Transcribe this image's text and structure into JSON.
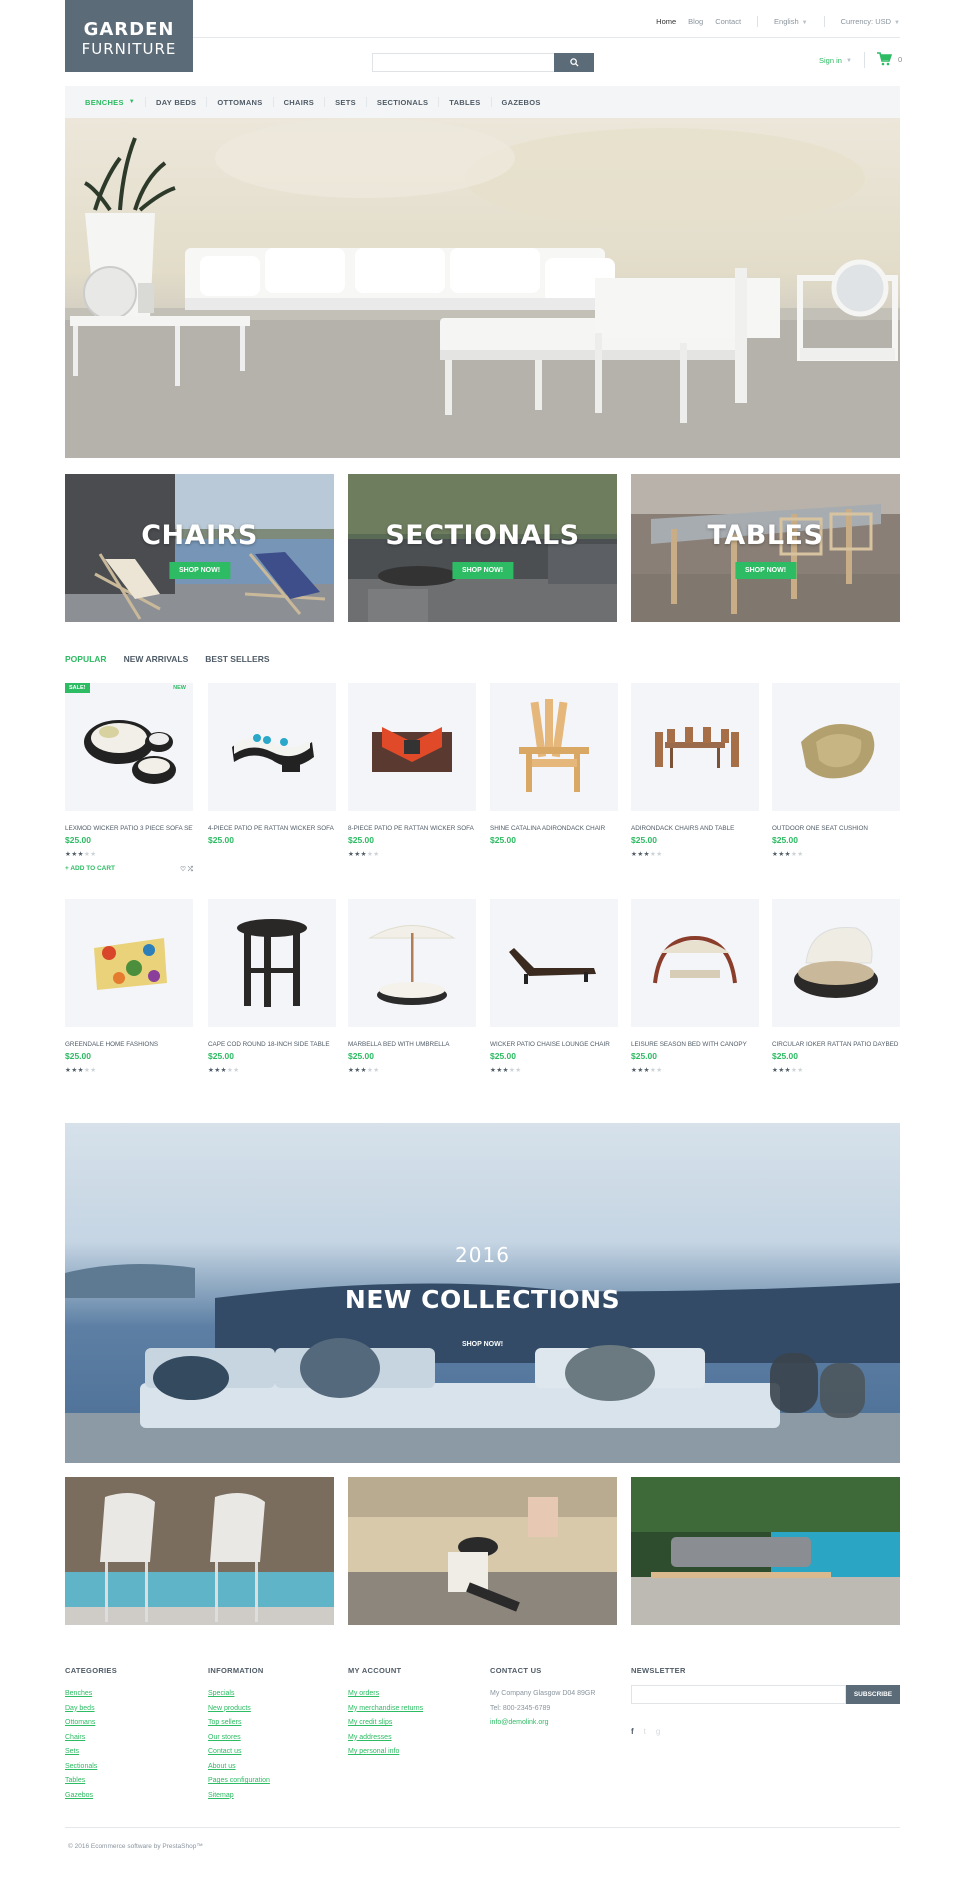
{
  "logo": {
    "line1": "GARDEN",
    "line2": "FURNITURE"
  },
  "topnav": {
    "home": "Home",
    "blog": "Blog",
    "contact": "Contact",
    "language": "English",
    "currency": "Currency: USD"
  },
  "search": {
    "placeholder": "",
    "value": ""
  },
  "account": {
    "signin": "Sign in",
    "cart_count": "0"
  },
  "menu": [
    "BENCHES",
    "DAY BEDS",
    "OTTOMANS",
    "CHAIRS",
    "SETS",
    "SECTIONALS",
    "TABLES",
    "GAZEBOS"
  ],
  "categories": [
    {
      "title": "CHAIRS",
      "button": "SHOP NOW!"
    },
    {
      "title": "SECTIONALS",
      "button": "SHOP NOW!"
    },
    {
      "title": "TABLES",
      "button": "SHOP NOW!"
    }
  ],
  "tabs": [
    "POPULAR",
    "NEW ARRIVALS",
    "BEST SELLERS"
  ],
  "badges": {
    "sale": "SALE!",
    "new": "NEW"
  },
  "add_to_cart": "+ ADD TO CART",
  "products": [
    {
      "name": "LEXMOD WICKER PATIO 3 PIECE SOFA SET",
      "price": "$25.00",
      "rating": 3
    },
    {
      "name": "4-PIECE PATIO PE RATTAN WICKER SOFA",
      "price": "$25.00",
      "rating": 0
    },
    {
      "name": "8-PIECE PATIO PE RATTAN WICKER SOFA",
      "price": "$25.00",
      "rating": 3
    },
    {
      "name": "SHINE CATALINA ADIRONDACK CHAIR",
      "price": "$25.00",
      "rating": 0
    },
    {
      "name": "ADIRONDACK CHAIRS AND TABLE",
      "price": "$25.00",
      "rating": 3
    },
    {
      "name": "OUTDOOR ONE SEAT CUSHION",
      "price": "$25.00",
      "rating": 3
    },
    {
      "name": "GREENDALE HOME FASHIONS",
      "price": "$25.00",
      "rating": 3
    },
    {
      "name": "CAPE COD ROUND 18-INCH SIDE TABLE",
      "price": "$25.00",
      "rating": 3
    },
    {
      "name": "MARBELLA BED WITH UMBRELLA",
      "price": "$25.00",
      "rating": 3
    },
    {
      "name": "WICKER PATIO CHAISE LOUNGE CHAIR",
      "price": "$25.00",
      "rating": 3
    },
    {
      "name": "LEISURE SEASON BED WITH CANOPY",
      "price": "$25.00",
      "rating": 3
    },
    {
      "name": "CIRCULAR IOKER RATTAN PATIO DAYBED",
      "price": "$25.00",
      "rating": 3
    }
  ],
  "collection": {
    "year": "2016",
    "title": "NEW COLLECTIONS",
    "button": "SHOP NOW!"
  },
  "footer": {
    "categories": {
      "title": "CATEGORIES",
      "links": [
        "Benches",
        "Day beds",
        "Ottomans",
        "Chairs",
        "Sets",
        "Sectionals",
        "Tables",
        "Gazebos"
      ]
    },
    "information": {
      "title": "INFORMATION",
      "links": [
        "Specials",
        "New products",
        "Top sellers",
        "Our stores",
        "Contact us",
        "About us",
        "Pages configuration",
        "Sitemap"
      ]
    },
    "account": {
      "title": "MY ACCOUNT",
      "links": [
        "My orders",
        "My merchandise returns",
        "My credit slips",
        "My addresses",
        "My personal info"
      ]
    },
    "contact": {
      "title": "CONTACT US",
      "address": "My Company Glasgow D04 89GR",
      "phone": "Tel: 800-2345-6789",
      "email": "info@demolink.org"
    },
    "newsletter": {
      "title": "NEWSLETTER",
      "placeholder": "",
      "button": "SUBSCRIBE"
    },
    "copyright": "© 2016 Ecommerce software by PrestaShop™"
  },
  "colors": {
    "accent": "#2dbb63",
    "slate": "#5b6b78"
  }
}
